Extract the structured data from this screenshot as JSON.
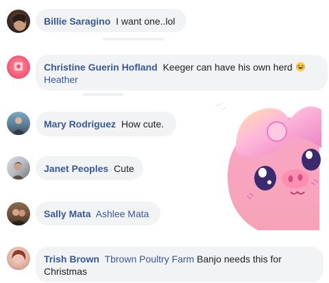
{
  "comments": [
    {
      "author": "Billie Saragino",
      "tags": [],
      "text": "I want one..lol"
    },
    {
      "author": "Christine Guerin Hofland",
      "text": "Keeger can have his own herd",
      "emoji": "rofl-emoji",
      "tags": [
        "Heather"
      ]
    },
    {
      "author": "Mary Rodriguez",
      "tags": [],
      "text": "How cute."
    },
    {
      "author": "Janet Peoples",
      "tags": [],
      "text": "Cute"
    },
    {
      "author": "Sally Mata",
      "tags": [
        "Ashlee Mata"
      ],
      "text": ""
    },
    {
      "author": "Trish Brown",
      "tags": [
        "Tbrown Poultry Farm"
      ],
      "text": "Banjo needs this for",
      "text2": "Christmas"
    }
  ],
  "sticker": {
    "icon": "pink-pig-sticker"
  },
  "colors": {
    "link": "#385898",
    "bubble": "#f2f3f5",
    "text": "#1c1e21",
    "pig": "#f7a1c4"
  }
}
